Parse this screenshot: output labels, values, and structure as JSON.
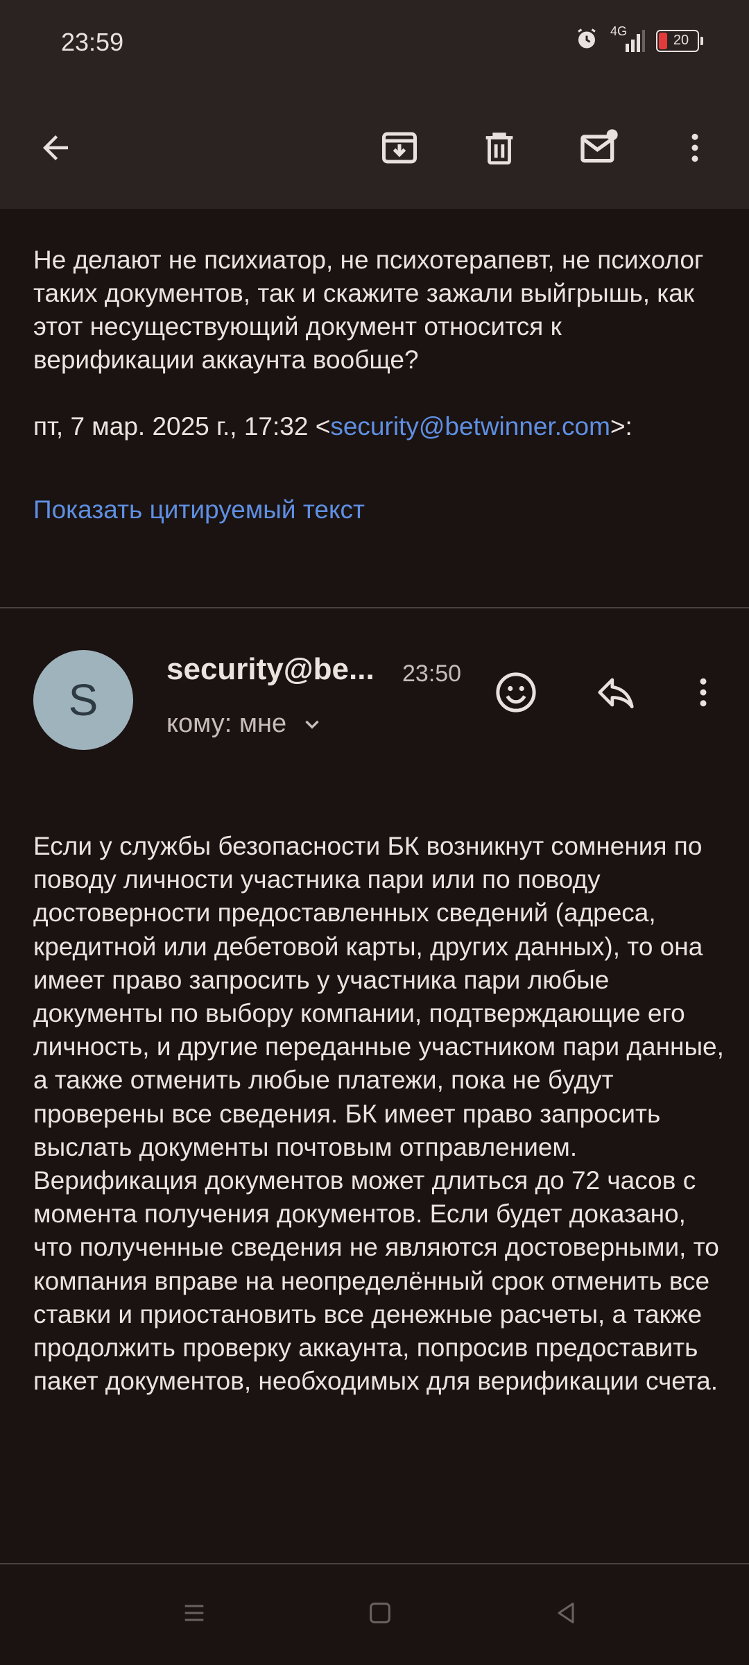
{
  "status_bar": {
    "time": "23:59",
    "network": "4G",
    "battery": "20",
    "icons": [
      "alarm-icon",
      "signal-icon",
      "battery-icon"
    ]
  },
  "toolbar": {
    "icons": [
      "back-arrow-icon",
      "archive-icon",
      "trash-icon",
      "mark-unread-icon",
      "more-vert-icon"
    ]
  },
  "quoted_message": {
    "text": "Не делают не психиатор, не психотерапевт, не психолог таких документов, так и скажите зажали выйгрышь, как этот несуществующий документ относится к верификации аккаунта вообще?",
    "date_prefix": "пт, 7 мар. 2025 г., 17:32 <",
    "date_email": "security@betwinner.com",
    "date_suffix": ">:",
    "show_quoted_label": "Показать цитируемый текст"
  },
  "message": {
    "avatar_letter": "S",
    "sender": "security@be...",
    "time": "23:50",
    "recipient_label": "кому: мне",
    "body": "Если у службы безопасности БК возникнут сомнения по поводу личности участника пари или по поводу достоверности предоставленных сведений (адреса, кредитной или дебетовой карты, других данных), то она имеет право запросить у участника пари любые документы по выбору компании, подтверждающие его личность, и другие переданные участником пари данные, а также отменить любые платежи, пока не будут проверены все сведения. БК имеет право запросить выслать документы почтовым отправлением. Верификация документов может длиться до 72 часов с момента получения документов. Если будет доказано, что полученные сведения не являются достоверными, то компания вправе на неопределённый срок отменить все ставки и приостановить все денежные расчеты, а также продолжить проверку аккаунта, попросив предоставить пакет документов, необходимых для верификации счета."
  },
  "colors": {
    "background": "#1a1311",
    "bar": "#2a2321",
    "link": "#5f8fe3",
    "avatar": "#9fb3bd"
  }
}
